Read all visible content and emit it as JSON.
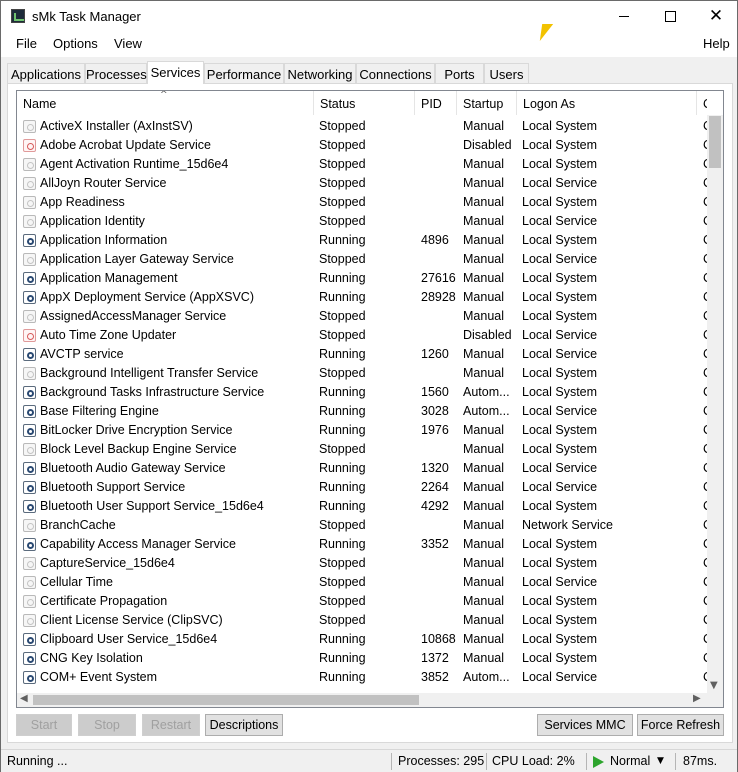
{
  "window": {
    "title": "sMk Task Manager"
  },
  "menu": {
    "file": "File",
    "options": "Options",
    "view": "View",
    "help": "Help"
  },
  "tabs": [
    "Applications",
    "Processes",
    "Services",
    "Performance",
    "Networking",
    "Connections",
    "Ports",
    "Users"
  ],
  "active_tab": "Services",
  "columns": {
    "name": "Name",
    "status": "Status",
    "pid": "PID",
    "startup": "Startup",
    "logon": "Logon As",
    "extra": "C"
  },
  "services": [
    {
      "name": "ActiveX Installer (AxInstSV)",
      "status": "Stopped",
      "pid": "",
      "startup": "Manual",
      "logon": "Local System",
      "extra": "C",
      "icon": "stopped"
    },
    {
      "name": "Adobe Acrobat Update Service",
      "status": "Stopped",
      "pid": "",
      "startup": "Disabled",
      "logon": "Local System",
      "extra": "C",
      "icon": "disabled"
    },
    {
      "name": "Agent Activation Runtime_15d6e4",
      "status": "Stopped",
      "pid": "",
      "startup": "Manual",
      "logon": "Local System",
      "extra": "C",
      "icon": "stopped"
    },
    {
      "name": "AllJoyn Router Service",
      "status": "Stopped",
      "pid": "",
      "startup": "Manual",
      "logon": "Local Service",
      "extra": "C",
      "icon": "stopped"
    },
    {
      "name": "App Readiness",
      "status": "Stopped",
      "pid": "",
      "startup": "Manual",
      "logon": "Local System",
      "extra": "C",
      "icon": "stopped"
    },
    {
      "name": "Application Identity",
      "status": "Stopped",
      "pid": "",
      "startup": "Manual",
      "logon": "Local Service",
      "extra": "C",
      "icon": "stopped"
    },
    {
      "name": "Application Information",
      "status": "Running",
      "pid": "4896",
      "startup": "Manual",
      "logon": "Local System",
      "extra": "C",
      "icon": "running"
    },
    {
      "name": "Application Layer Gateway Service",
      "status": "Stopped",
      "pid": "",
      "startup": "Manual",
      "logon": "Local Service",
      "extra": "C",
      "icon": "stopped"
    },
    {
      "name": "Application Management",
      "status": "Running",
      "pid": "27616",
      "startup": "Manual",
      "logon": "Local System",
      "extra": "C",
      "icon": "running"
    },
    {
      "name": "AppX Deployment Service (AppXSVC)",
      "status": "Running",
      "pid": "28928",
      "startup": "Manual",
      "logon": "Local System",
      "extra": "C",
      "icon": "running"
    },
    {
      "name": "AssignedAccessManager Service",
      "status": "Stopped",
      "pid": "",
      "startup": "Manual",
      "logon": "Local System",
      "extra": "C",
      "icon": "stopped"
    },
    {
      "name": "Auto Time Zone Updater",
      "status": "Stopped",
      "pid": "",
      "startup": "Disabled",
      "logon": "Local Service",
      "extra": "C",
      "icon": "disabled"
    },
    {
      "name": "AVCTP service",
      "status": "Running",
      "pid": "1260",
      "startup": "Manual",
      "logon": "Local Service",
      "extra": "C",
      "icon": "running"
    },
    {
      "name": "Background Intelligent Transfer Service",
      "status": "Stopped",
      "pid": "",
      "startup": "Manual",
      "logon": "Local System",
      "extra": "C",
      "icon": "stopped"
    },
    {
      "name": "Background Tasks Infrastructure Service",
      "status": "Running",
      "pid": "1560",
      "startup": "Autom...",
      "logon": "Local System",
      "extra": "C",
      "icon": "running"
    },
    {
      "name": "Base Filtering Engine",
      "status": "Running",
      "pid": "3028",
      "startup": "Autom...",
      "logon": "Local Service",
      "extra": "C",
      "icon": "running"
    },
    {
      "name": "BitLocker Drive Encryption Service",
      "status": "Running",
      "pid": "1976",
      "startup": "Manual",
      "logon": "Local System",
      "extra": "C",
      "icon": "running"
    },
    {
      "name": "Block Level Backup Engine Service",
      "status": "Stopped",
      "pid": "",
      "startup": "Manual",
      "logon": "Local System",
      "extra": "C",
      "icon": "stopped"
    },
    {
      "name": "Bluetooth Audio Gateway Service",
      "status": "Running",
      "pid": "1320",
      "startup": "Manual",
      "logon": "Local Service",
      "extra": "C",
      "icon": "running"
    },
    {
      "name": "Bluetooth Support Service",
      "status": "Running",
      "pid": "2264",
      "startup": "Manual",
      "logon": "Local Service",
      "extra": "C",
      "icon": "running"
    },
    {
      "name": "Bluetooth User Support Service_15d6e4",
      "status": "Running",
      "pid": "4292",
      "startup": "Manual",
      "logon": "Local System",
      "extra": "C",
      "icon": "running"
    },
    {
      "name": "BranchCache",
      "status": "Stopped",
      "pid": "",
      "startup": "Manual",
      "logon": "Network Service",
      "extra": "C",
      "icon": "stopped"
    },
    {
      "name": "Capability Access Manager Service",
      "status": "Running",
      "pid": "3352",
      "startup": "Manual",
      "logon": "Local System",
      "extra": "C",
      "icon": "running"
    },
    {
      "name": "CaptureService_15d6e4",
      "status": "Stopped",
      "pid": "",
      "startup": "Manual",
      "logon": "Local System",
      "extra": "C",
      "icon": "stopped"
    },
    {
      "name": "Cellular Time",
      "status": "Stopped",
      "pid": "",
      "startup": "Manual",
      "logon": "Local Service",
      "extra": "C",
      "icon": "stopped"
    },
    {
      "name": "Certificate Propagation",
      "status": "Stopped",
      "pid": "",
      "startup": "Manual",
      "logon": "Local System",
      "extra": "C",
      "icon": "stopped"
    },
    {
      "name": "Client License Service (ClipSVC)",
      "status": "Stopped",
      "pid": "",
      "startup": "Manual",
      "logon": "Local System",
      "extra": "C",
      "icon": "stopped"
    },
    {
      "name": "Clipboard User Service_15d6e4",
      "status": "Running",
      "pid": "10868",
      "startup": "Manual",
      "logon": "Local System",
      "extra": "C",
      "icon": "running"
    },
    {
      "name": "CNG Key Isolation",
      "status": "Running",
      "pid": "1372",
      "startup": "Manual",
      "logon": "Local System",
      "extra": "C",
      "icon": "running"
    },
    {
      "name": "COM+ Event System",
      "status": "Running",
      "pid": "3852",
      "startup": "Autom...",
      "logon": "Local Service",
      "extra": "C",
      "icon": "running"
    }
  ],
  "buttons": {
    "start": "Start",
    "stop": "Stop",
    "restart": "Restart",
    "descriptions": "Descriptions",
    "services_mmc": "Services MMC",
    "force_refresh": "Force Refresh"
  },
  "statusbar": {
    "state": "Running ...",
    "processes": "Processes: 295",
    "cpu_load": "CPU Load: 2%",
    "priority": "Normal",
    "refresh_time": "87ms."
  }
}
